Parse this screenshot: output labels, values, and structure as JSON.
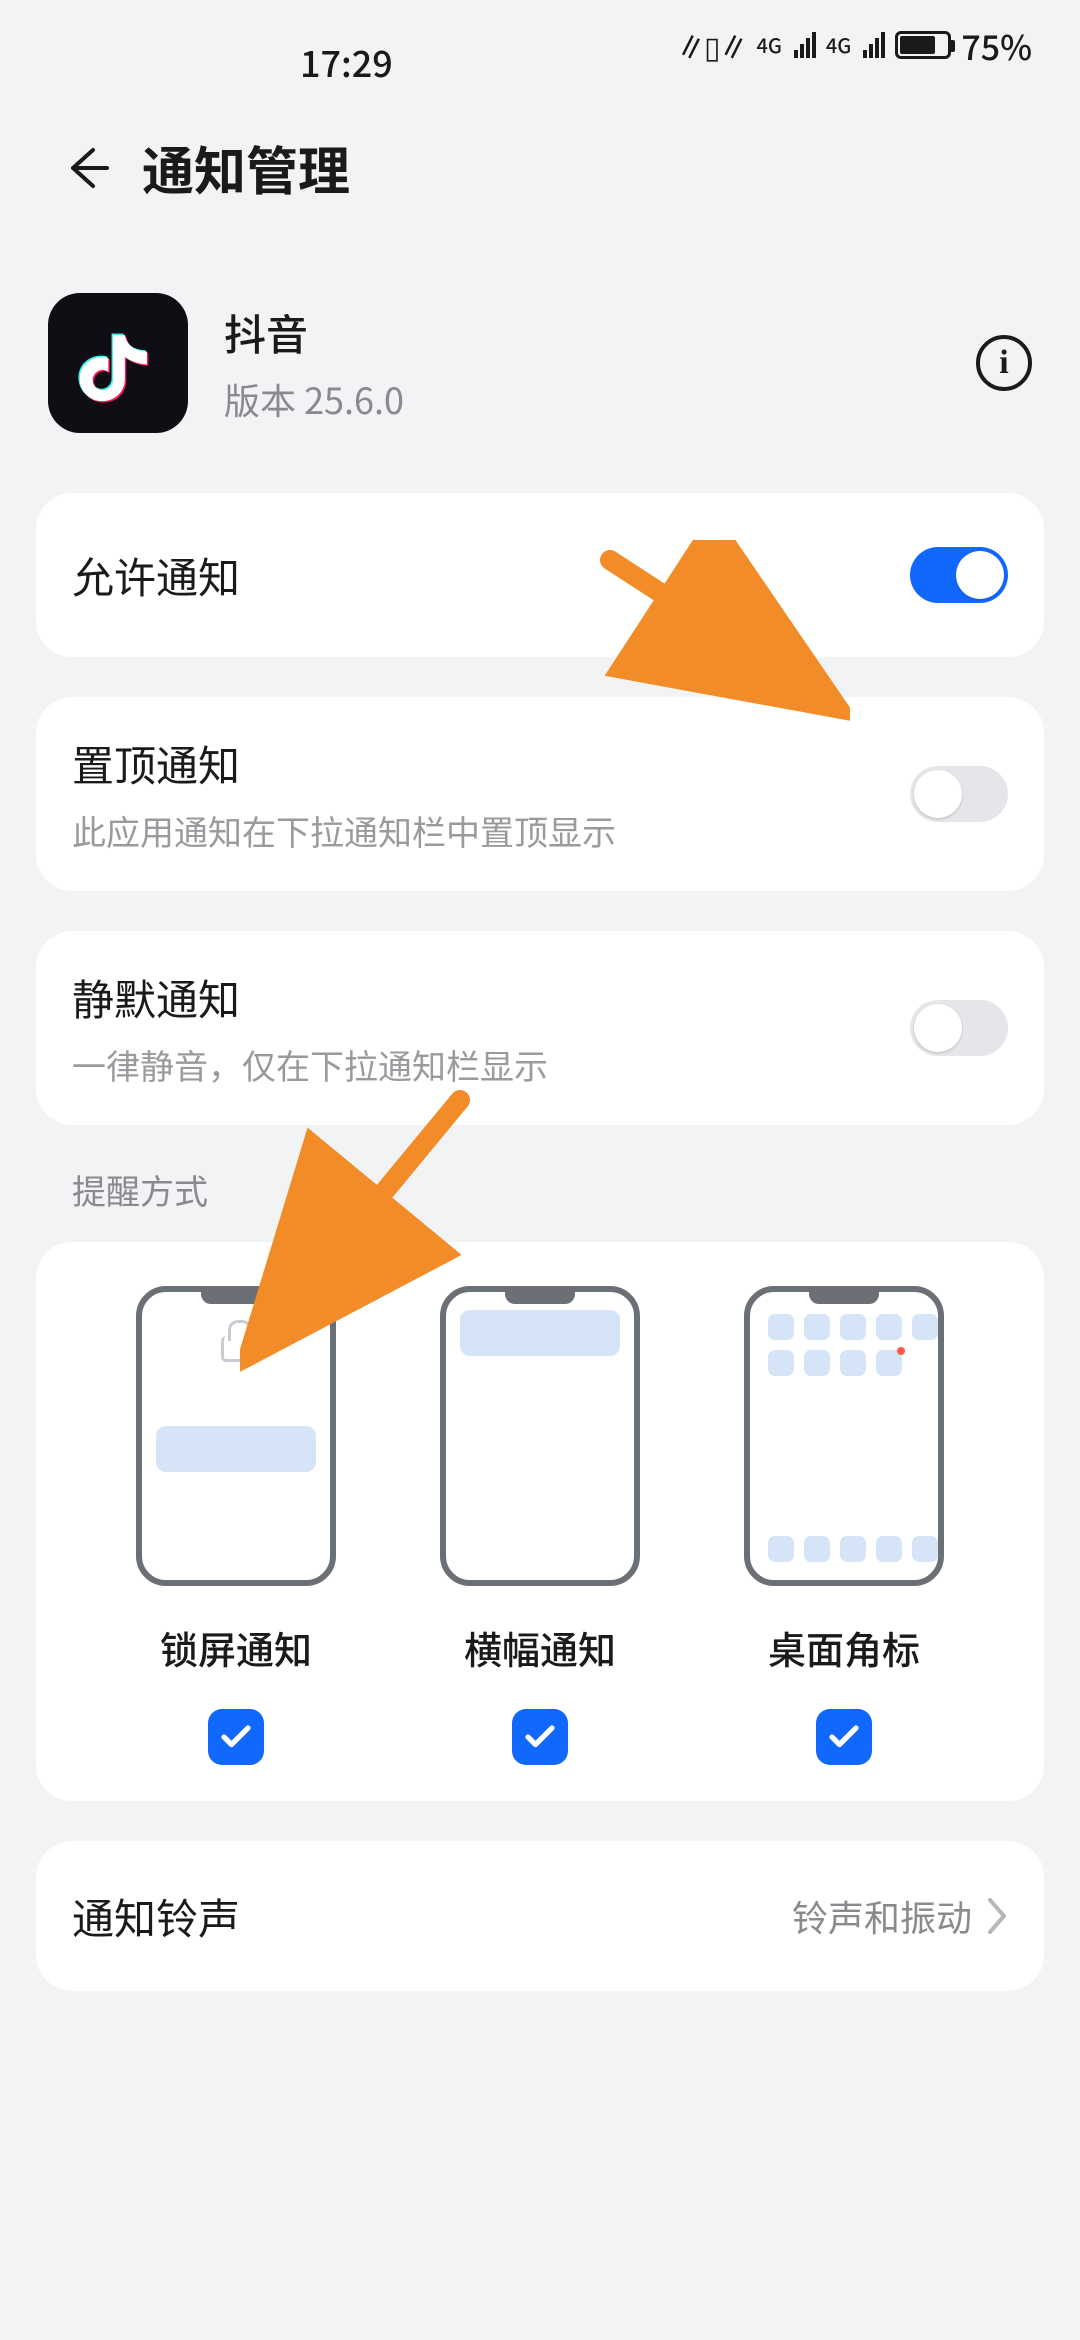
{
  "status": {
    "time": "17:29",
    "net_label": "4G",
    "battery_pct": "75%"
  },
  "header": {
    "title": "通知管理"
  },
  "app": {
    "name": "抖音",
    "version_prefix": "版本 ",
    "version": "25.6.0"
  },
  "rows": {
    "allow": {
      "title": "允许通知",
      "on": true
    },
    "pin": {
      "title": "置顶通知",
      "sub": "此应用通知在下拉通知栏中置顶显示",
      "on": false
    },
    "silent": {
      "title": "静默通知",
      "sub": "一律静音，仅在下拉通知栏显示",
      "on": false
    }
  },
  "section_methods": "提醒方式",
  "methods": {
    "lock": {
      "label": "锁屏通知",
      "checked": true
    },
    "banner": {
      "label": "横幅通知",
      "checked": true
    },
    "badge": {
      "label": "桌面角标",
      "checked": true
    }
  },
  "ringtone": {
    "title": "通知铃声",
    "value": "铃声和振动"
  }
}
